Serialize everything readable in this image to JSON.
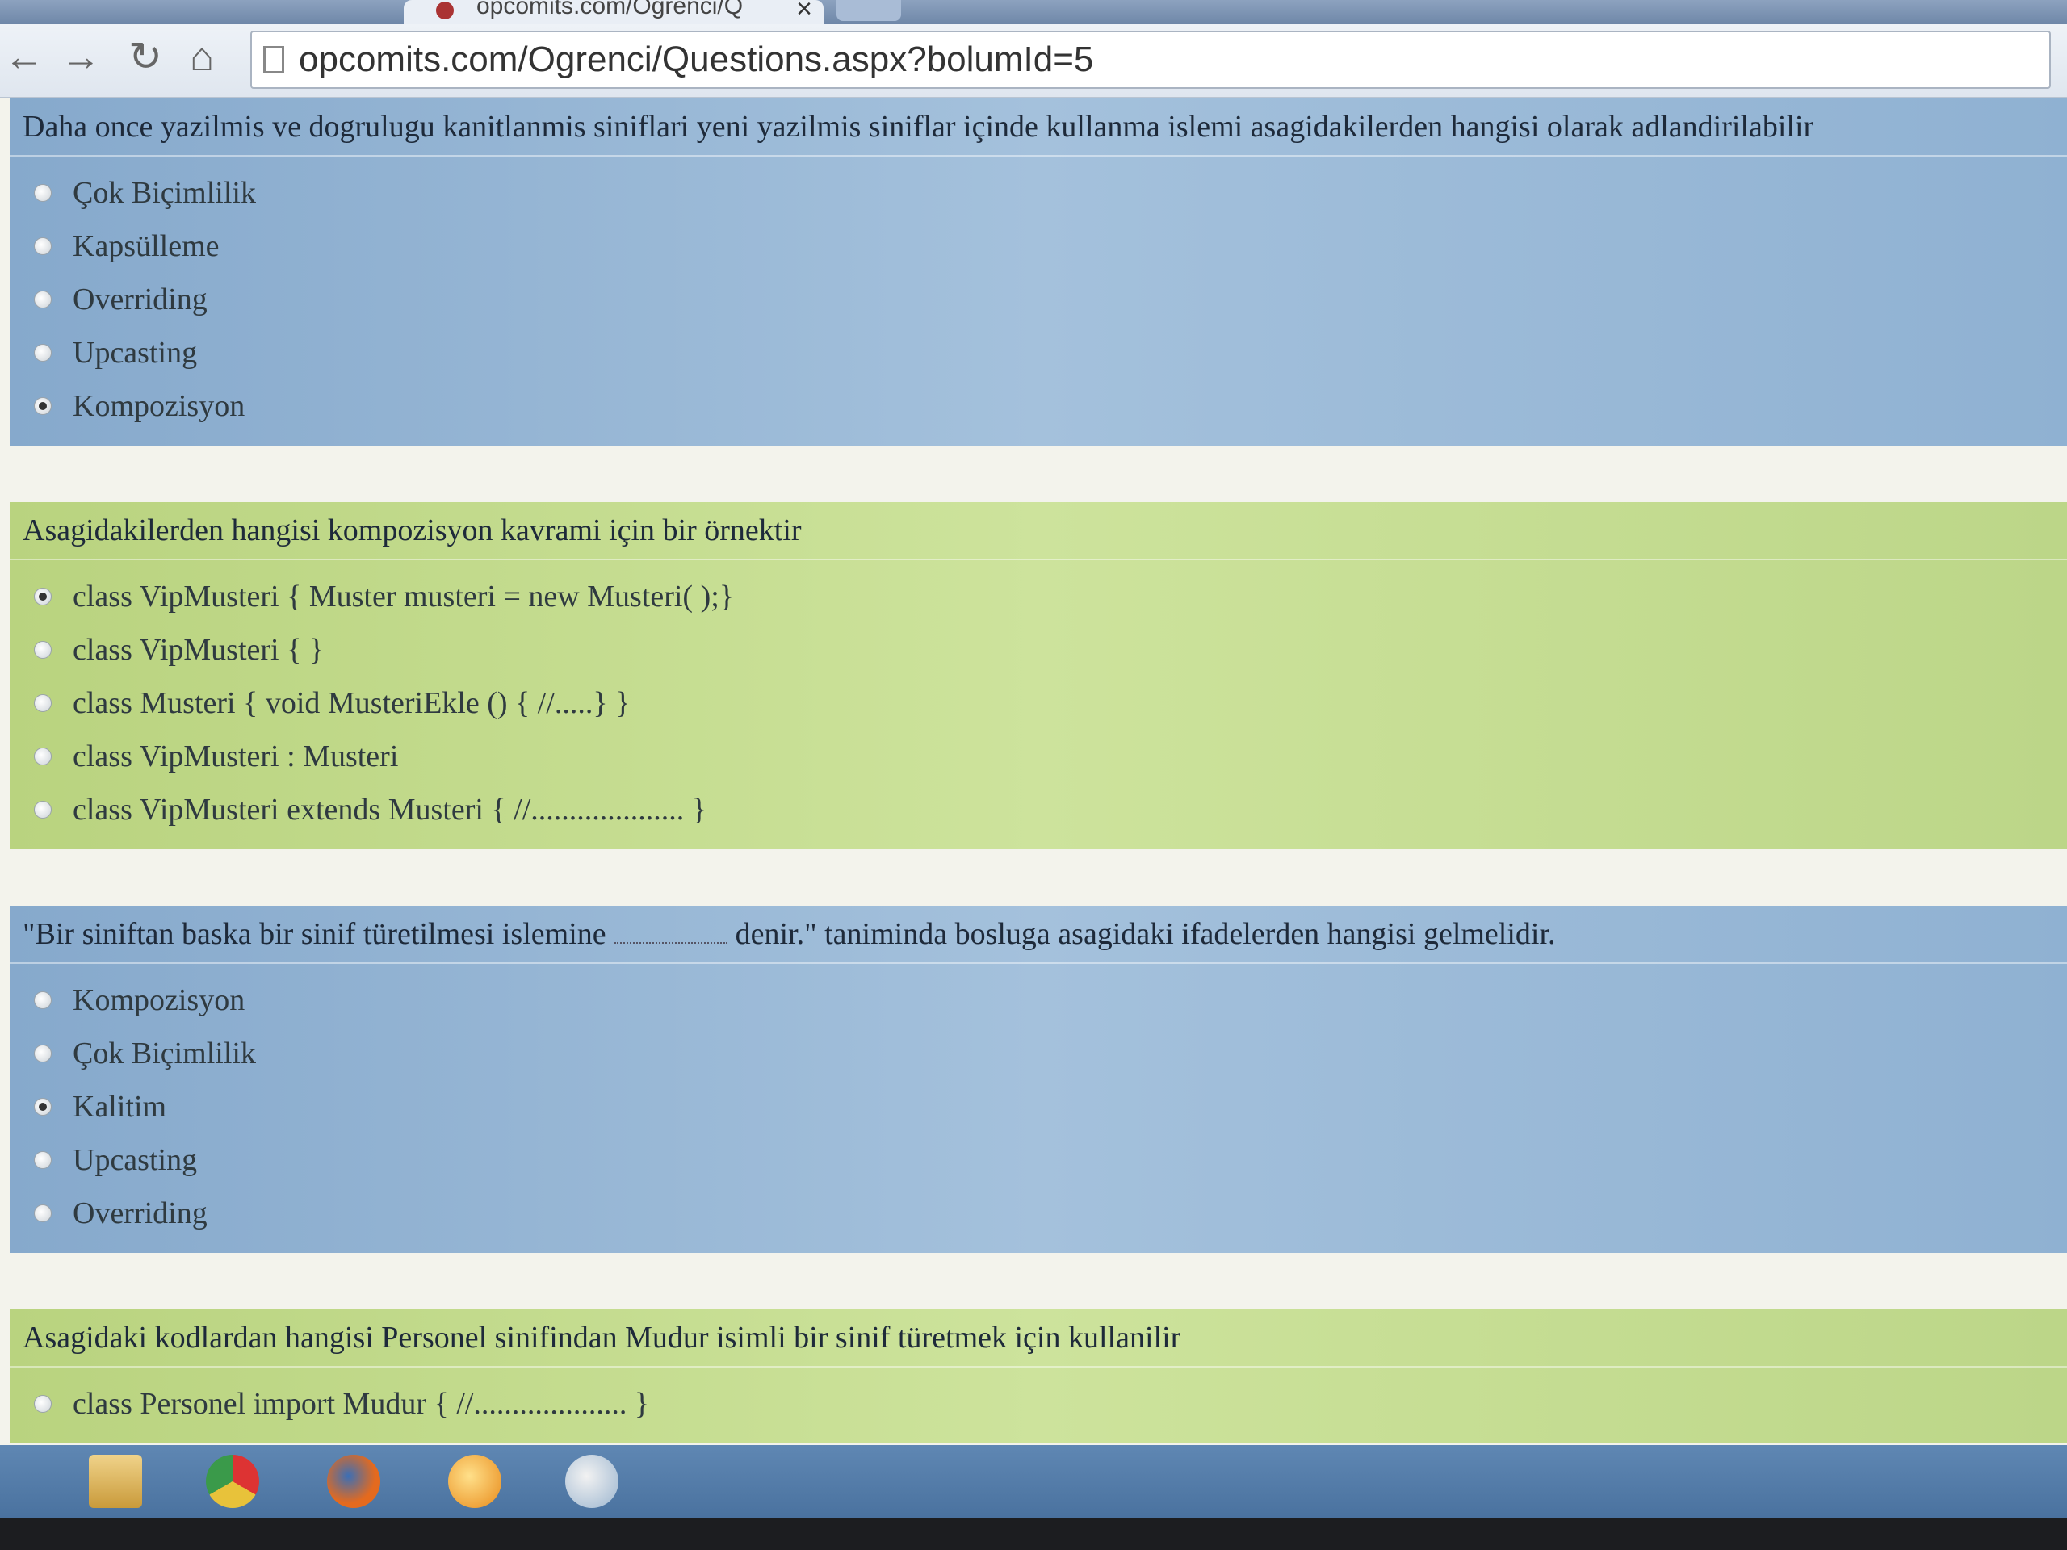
{
  "browser": {
    "tab_title": "opcomits.com/Ogrenci/Q",
    "tab_close": "×",
    "url": "opcomits.com/Ogrenci/Questions.aspx?bolumId=5",
    "icons": [
      "back-arrow",
      "forward-arrow",
      "reload",
      "home"
    ]
  },
  "questions": [
    {
      "text": "Daha once yazilmis ve dogrulugu kanitlanmis siniflari yeni yazilmis siniflar içinde kullanma islemi asagidakilerden hangisi olarak adlandirilabilir",
      "options": [
        "Çok Biçimlilik",
        "Kapsülleme",
        "Overriding",
        "Upcasting",
        "Kompozisyon"
      ],
      "selected": 4
    },
    {
      "text": "Asagidakilerden hangisi kompozisyon kavrami için bir örnektir",
      "options": [
        "class VipMusteri { Muster musteri = new Musteri( );}",
        "class VipMusteri { }",
        "class Musteri { void MusteriEkle () { //.....} }",
        "class VipMusteri : Musteri",
        "class VipMusteri extends Musteri { //.................... }"
      ],
      "selected": 0
    },
    {
      "text_before": "\"Bir siniftan baska bir sinif türetilmesi islemine",
      "text_after": "denir.\" taniminda bosluga asagidaki ifadelerden hangisi gelmelidir.",
      "options": [
        "Kompozisyon",
        "Çok Biçimlilik",
        "Kalitim",
        "Upcasting",
        "Overriding"
      ],
      "selected": 2
    },
    {
      "text": "Asagidaki kodlardan hangisi Personel sinifindan Mudur isimli bir sinif türetmek için kullanilir",
      "options": [
        "class Personel import Mudur { //.................... }"
      ],
      "selected": -1
    }
  ],
  "colors": {
    "question_blue": "#9bbad8",
    "question_green": "#c6de93",
    "taskbar": "#5a82ae"
  },
  "taskbar_icons": [
    "windows-explorer-icon",
    "chrome-icon",
    "firefox-icon",
    "orange-app-icon",
    "paint-icon"
  ]
}
